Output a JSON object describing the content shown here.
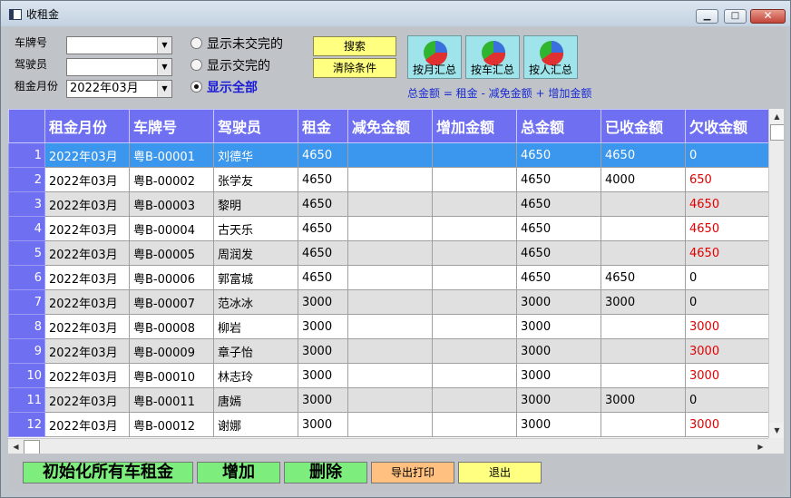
{
  "window": {
    "title": "收租金",
    "minimize_glyph": "▁",
    "maximize_glyph": "□",
    "close_glyph": "✕"
  },
  "filters": {
    "plate_label": "车牌号",
    "driver_label": "驾驶员",
    "month_label": "租金月份",
    "plate_value": "",
    "driver_value": "",
    "month_value": "2022年03月"
  },
  "radios": [
    {
      "label": "显示未交完的",
      "selected": false
    },
    {
      "label": "显示交完的",
      "selected": false
    },
    {
      "label": "显示全部",
      "selected": true
    }
  ],
  "buttons": {
    "search": "搜索",
    "clear": "清除条件",
    "by_month": "按月汇总",
    "by_car": "按车汇总",
    "by_person": "按人汇总",
    "init_all": "初始化所有车租金",
    "add": "增加",
    "delete": "删除",
    "export_print": "导出打印",
    "exit": "退出"
  },
  "formula": "总金额 = 租金 - 减免金额 + 增加金额",
  "colors": {
    "header_bg": "#6f6ff2",
    "selected_row": "#3b97ee",
    "owed_text": "#e00000",
    "highlight_button": "#ffff80",
    "green_button": "#7ded7d",
    "orange_button": "#ffc080"
  },
  "icons": {
    "summary": "pie-chart-icon"
  },
  "table": {
    "columns": [
      "租金月份",
      "车牌号",
      "驾驶员",
      "租金",
      "减免金额",
      "增加金额",
      "总金额",
      "已收金额",
      "欠收金额"
    ],
    "rows": [
      {
        "no": "1",
        "month": "2022年03月",
        "plate": "粤B-00001",
        "driver": "刘德华",
        "rent": "4650",
        "discount": "",
        "extra": "",
        "total": "4650",
        "received": "4650",
        "owed": "0",
        "selected": true
      },
      {
        "no": "2",
        "month": "2022年03月",
        "plate": "粤B-00002",
        "driver": "张学友",
        "rent": "4650",
        "discount": "",
        "extra": "",
        "total": "4650",
        "received": "4000",
        "owed": "650"
      },
      {
        "no": "3",
        "month": "2022年03月",
        "plate": "粤B-00003",
        "driver": "黎明",
        "rent": "4650",
        "discount": "",
        "extra": "",
        "total": "4650",
        "received": "",
        "owed": "4650"
      },
      {
        "no": "4",
        "month": "2022年03月",
        "plate": "粤B-00004",
        "driver": "古天乐",
        "rent": "4650",
        "discount": "",
        "extra": "",
        "total": "4650",
        "received": "",
        "owed": "4650"
      },
      {
        "no": "5",
        "month": "2022年03月",
        "plate": "粤B-00005",
        "driver": "周润发",
        "rent": "4650",
        "discount": "",
        "extra": "",
        "total": "4650",
        "received": "",
        "owed": "4650"
      },
      {
        "no": "6",
        "month": "2022年03月",
        "plate": "粤B-00006",
        "driver": "郭富城",
        "rent": "4650",
        "discount": "",
        "extra": "",
        "total": "4650",
        "received": "4650",
        "owed": "0"
      },
      {
        "no": "7",
        "month": "2022年03月",
        "plate": "粤B-00007",
        "driver": "范冰冰",
        "rent": "3000",
        "discount": "",
        "extra": "",
        "total": "3000",
        "received": "3000",
        "owed": "0"
      },
      {
        "no": "8",
        "month": "2022年03月",
        "plate": "粤B-00008",
        "driver": "柳岩",
        "rent": "3000",
        "discount": "",
        "extra": "",
        "total": "3000",
        "received": "",
        "owed": "3000"
      },
      {
        "no": "9",
        "month": "2022年03月",
        "plate": "粤B-00009",
        "driver": "章子怡",
        "rent": "3000",
        "discount": "",
        "extra": "",
        "total": "3000",
        "received": "",
        "owed": "3000"
      },
      {
        "no": "10",
        "month": "2022年03月",
        "plate": "粤B-00010",
        "driver": "林志玲",
        "rent": "3000",
        "discount": "",
        "extra": "",
        "total": "3000",
        "received": "",
        "owed": "3000"
      },
      {
        "no": "11",
        "month": "2022年03月",
        "plate": "粤B-00011",
        "driver": "唐嫣",
        "rent": "3000",
        "discount": "",
        "extra": "",
        "total": "3000",
        "received": "3000",
        "owed": "0"
      },
      {
        "no": "12",
        "month": "2022年03月",
        "plate": "粤B-00012",
        "driver": "谢娜",
        "rent": "3000",
        "discount": "",
        "extra": "",
        "total": "3000",
        "received": "",
        "owed": "3000"
      }
    ]
  }
}
